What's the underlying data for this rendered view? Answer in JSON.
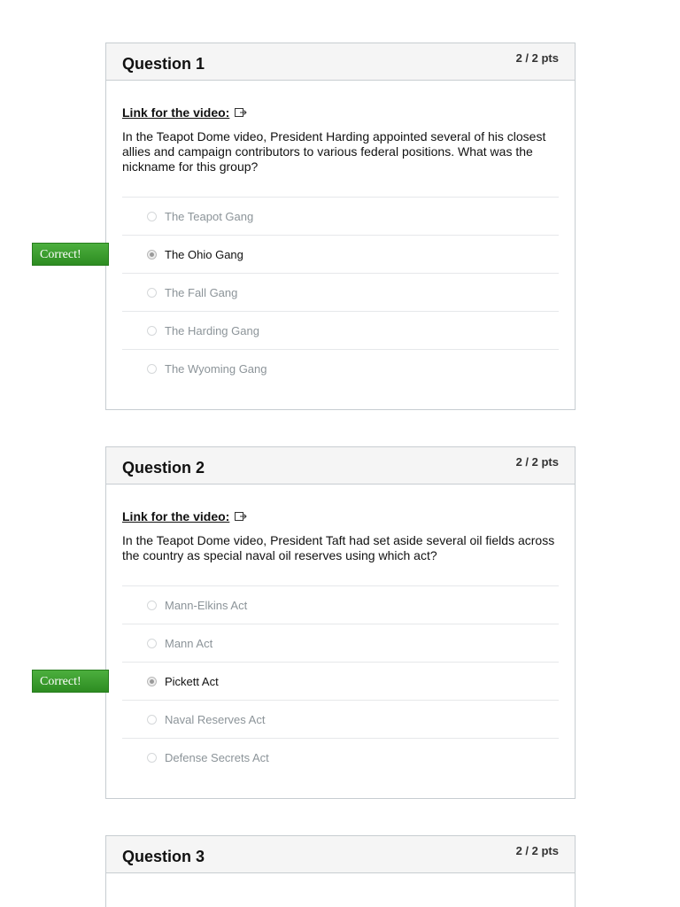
{
  "questions": [
    {
      "title": "Question 1",
      "points": "2 / 2 pts",
      "video_link_label": "Link for the video:",
      "text": "In the Teapot Dome video, President Harding appointed several of his closest allies and campaign contributors to various federal positions. What was the nickname for this group?",
      "answers": [
        {
          "label": "The Teapot Gang",
          "selected": false
        },
        {
          "label": "The Ohio Gang",
          "selected": true
        },
        {
          "label": "The Fall Gang",
          "selected": false
        },
        {
          "label": "The Harding Gang",
          "selected": false
        },
        {
          "label": "The Wyoming Gang",
          "selected": false
        }
      ],
      "result_flag": "Correct!"
    },
    {
      "title": "Question 2",
      "points": "2 / 2 pts",
      "video_link_label": "Link for the video:",
      "text": "In the Teapot Dome video, President Taft had set aside several oil fields across the country as special naval oil reserves using which act?",
      "answers": [
        {
          "label": "Mann-Elkins Act",
          "selected": false
        },
        {
          "label": "Mann Act",
          "selected": false
        },
        {
          "label": "Pickett Act",
          "selected": true
        },
        {
          "label": "Naval Reserves Act",
          "selected": false
        },
        {
          "label": "Defense Secrets Act",
          "selected": false
        }
      ],
      "result_flag": "Correct!"
    },
    {
      "title": "Question 3",
      "points": "2 / 2 pts"
    }
  ],
  "colors": {
    "correct_flag": "#3d9e30",
    "header_bg": "#f5f5f5",
    "border": "#c7cdd1"
  },
  "icons": {
    "external_link": "external-link-icon"
  }
}
